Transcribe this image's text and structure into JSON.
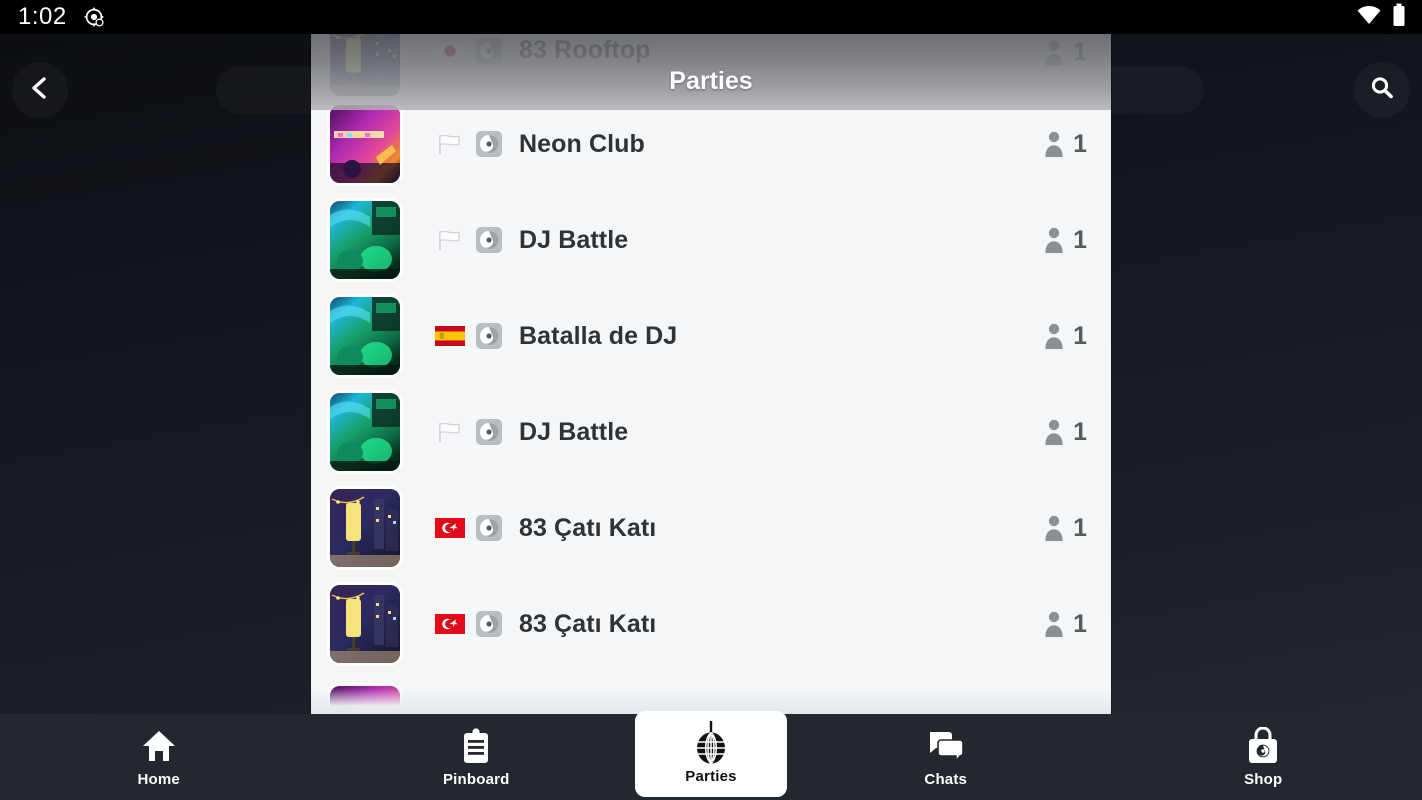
{
  "status_bar": {
    "time": "1:02",
    "left_icon": "location-target-icon",
    "wifi_icon": "wifi-icon",
    "battery_icon": "battery-icon"
  },
  "background": {
    "back_icon": "chevron-left-icon",
    "search_icon": "search-icon",
    "search_placeholder": ""
  },
  "panel": {
    "title": "Parties",
    "parties": [
      {
        "name": "83 Rooftop",
        "flag": "jp",
        "flag_label": "Japan",
        "type_icon": "disco-disc-icon",
        "members": "1",
        "thumb": "rooftop",
        "state": "partial-top"
      },
      {
        "name": "Neon Club",
        "flag": "white",
        "flag_label": "No country",
        "type_icon": "disco-disc-icon",
        "members": "1",
        "thumb": "neon",
        "state": "full"
      },
      {
        "name": "DJ Battle",
        "flag": "white",
        "flag_label": "No country",
        "type_icon": "disco-disc-icon",
        "members": "1",
        "thumb": "dj",
        "state": "full"
      },
      {
        "name": "Batalla de DJ",
        "flag": "es",
        "flag_label": "Spain",
        "type_icon": "disco-disc-icon",
        "members": "1",
        "thumb": "dj",
        "state": "full"
      },
      {
        "name": "DJ Battle",
        "flag": "white",
        "flag_label": "No country",
        "type_icon": "disco-disc-icon",
        "members": "1",
        "thumb": "dj",
        "state": "full"
      },
      {
        "name": "83 Çatı Katı",
        "flag": "tr",
        "flag_label": "Turkey",
        "type_icon": "disco-disc-icon",
        "members": "1",
        "thumb": "rooftop",
        "state": "full"
      },
      {
        "name": "83 Çatı Katı",
        "flag": "tr",
        "flag_label": "Turkey",
        "type_icon": "disco-disc-icon",
        "members": "1",
        "thumb": "rooftop",
        "state": "full"
      },
      {
        "name": "",
        "flag": "none",
        "flag_label": "",
        "type_icon": "",
        "members": "",
        "thumb": "neon",
        "state": "partial-bottom"
      }
    ]
  },
  "bottom_nav": {
    "items": [
      {
        "label": "Home",
        "icon": "home-icon",
        "active": false
      },
      {
        "label": "Pinboard",
        "icon": "clipboard-icon",
        "active": false
      },
      {
        "label": "Parties",
        "icon": "disco-ball-icon",
        "active": true
      },
      {
        "label": "Chats",
        "icon": "chat-bubbles-icon",
        "active": false
      },
      {
        "label": "Shop",
        "icon": "shopping-bag-icon",
        "active": false
      }
    ]
  },
  "colors": {
    "nav_bg": "#23282f",
    "panel_bg": "#f4f6f8",
    "accent_active": "#ffffff",
    "text_primary": "#2e3338",
    "status_bg": "#000000"
  }
}
